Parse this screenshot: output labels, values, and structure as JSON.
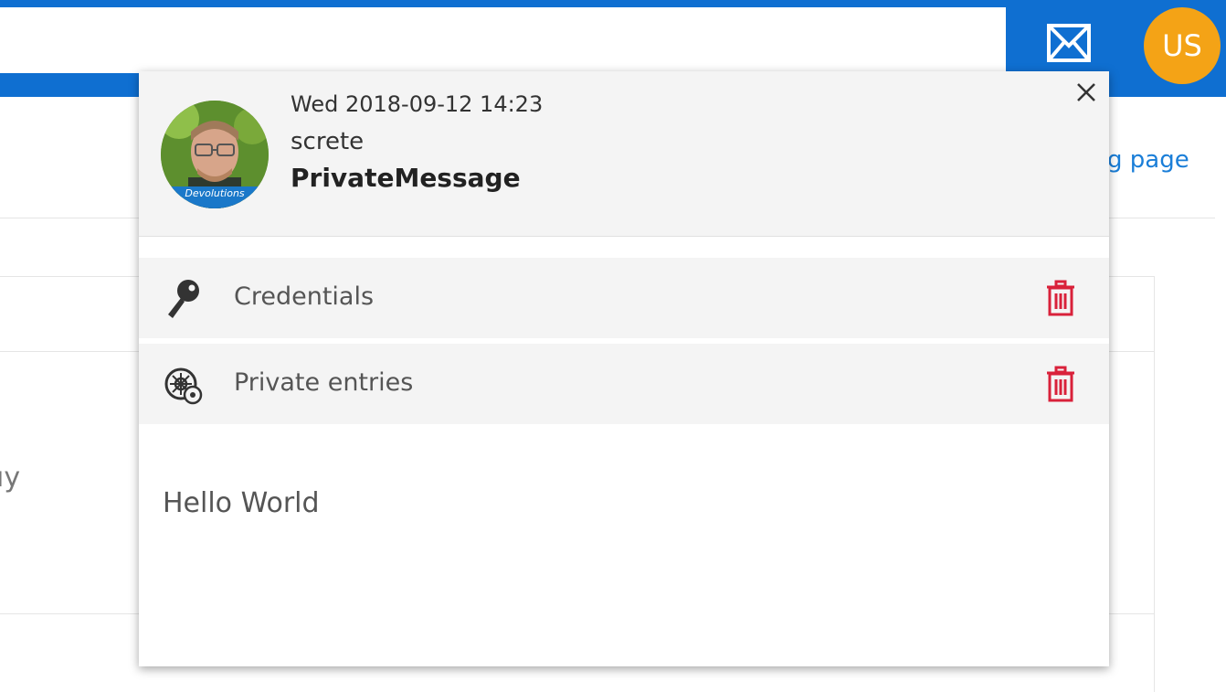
{
  "topbar": {
    "search_value": "",
    "avatar_initials": "US",
    "mail_icon": "mail-icon",
    "colors": {
      "bar": "#0f6fd1",
      "avatar": "#f4a316"
    }
  },
  "background": {
    "link_text": "g page",
    "partial_text": "ıy"
  },
  "popup": {
    "timestamp": "Wed 2018-09-12 14:23",
    "sender": "screte",
    "subject": "PrivateMessage",
    "avatar_badge": "Devolutions",
    "close_icon": "close-icon",
    "attachments": [
      {
        "label": "Credentials",
        "icon": "key-icon",
        "action_icon": "trash-icon"
      },
      {
        "label": "Private entries",
        "icon": "private-entries-icon",
        "action_icon": "trash-icon"
      }
    ],
    "body": "Hello World",
    "colors": {
      "header_bg": "#f4f4f4",
      "delete": "#d9213a"
    }
  }
}
